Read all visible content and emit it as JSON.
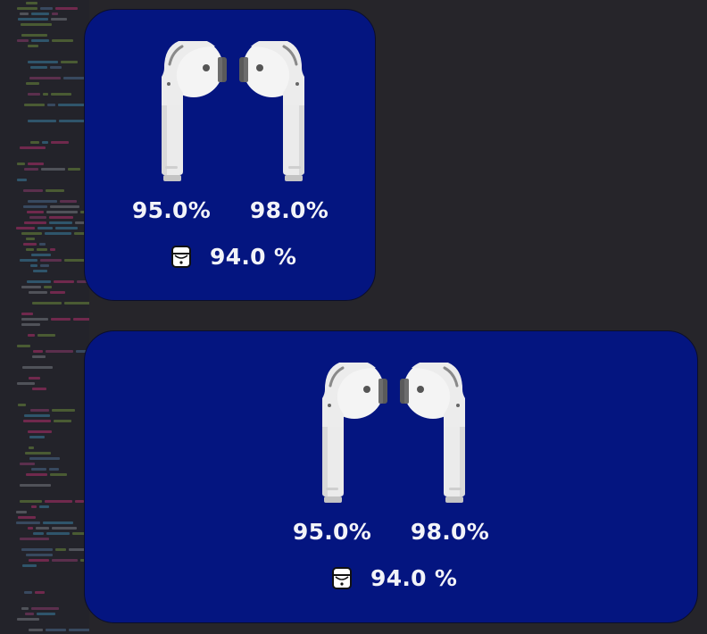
{
  "widgets": [
    {
      "name": "small",
      "left_label": "95.0%",
      "right_label": "98.0%",
      "case_label": "94.0 %"
    },
    {
      "name": "medium",
      "left_label": "95.0%",
      "right_label": "98.0%",
      "case_label": "94.0 %"
    }
  ],
  "colors": {
    "widget_background": "#041580",
    "text": "#f2f3f8",
    "desktop_background": "#26252a"
  },
  "icons": [
    "left-airpod-icon",
    "right-airpod-icon",
    "airpods-case-icon"
  ]
}
